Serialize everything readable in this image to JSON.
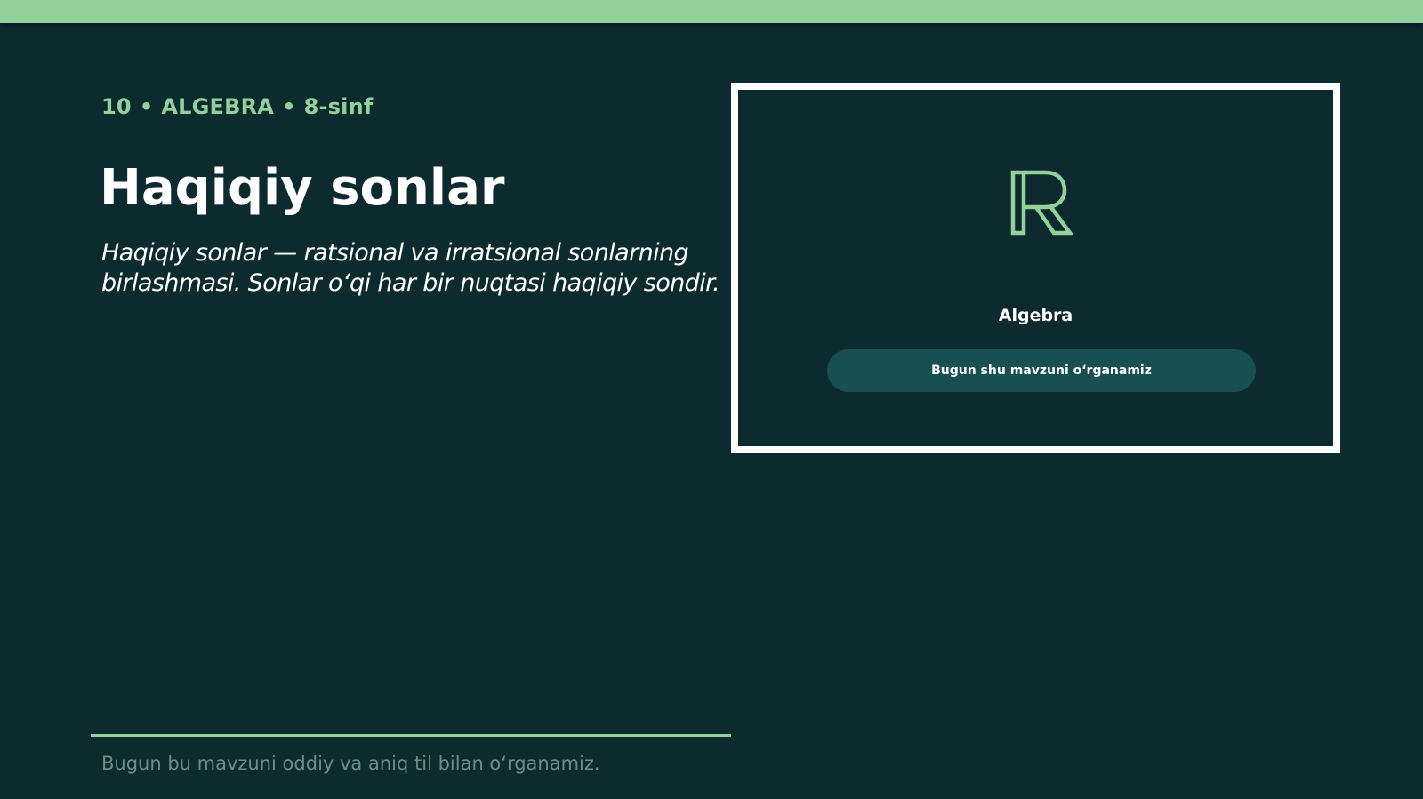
{
  "colors": {
    "background": "#0d2b2f",
    "accent": "#92d19b",
    "card_border": "#ffffff",
    "button_bg": "#184f51",
    "muted_text": "#6f8c8a"
  },
  "kicker": {
    "number": "10",
    "separator": "•",
    "subject": "ALGEBRA",
    "grade": "8-sinf"
  },
  "lesson": {
    "title": "Haqiqiy sonlar",
    "subtitle": "Haqiqiy sonlar — ratsional va irratsional sonlarning birlashmasi. Sonlar o‘qi har bir nuqtasi haqiqiy sondir."
  },
  "card": {
    "icon": "double-struck-r-icon",
    "label": "Algebra",
    "button_label": "Bugun shu mavzuni o‘rganamiz"
  },
  "footer": {
    "note": "Bugun bu mavzuni oddiy va aniq til bilan o‘rganamiz."
  }
}
